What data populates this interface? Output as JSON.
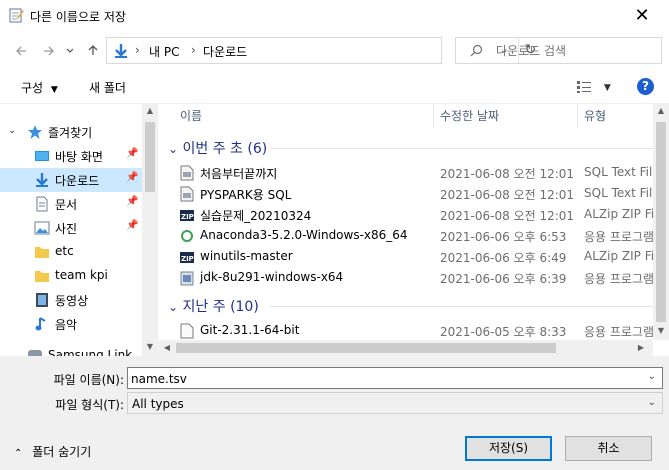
{
  "window": {
    "title": "다른 이름으로 저장",
    "close_glyph": "✕"
  },
  "nav": {
    "back_icon": "back-arrow-icon",
    "forward_icon": "forward-arrow-icon",
    "recent_icon": "chevron-down-icon",
    "up_icon": "up-arrow-icon"
  },
  "address": {
    "separator": "›",
    "crumbs": [
      "내 PC",
      "다운로드"
    ],
    "refresh_glyph": "↻"
  },
  "search": {
    "placeholder": "다운로드 검색"
  },
  "toolbar": {
    "organize_label": "구성",
    "new_folder_label": "새 폴더",
    "help_label": "?"
  },
  "sidebar": {
    "items": [
      {
        "label": "즐겨찾기",
        "icon": "star-icon"
      },
      {
        "label": "바탕 화면",
        "icon": "desktop-icon"
      },
      {
        "label": "다운로드",
        "icon": "download-icon"
      },
      {
        "label": "문서",
        "icon": "document-icon"
      },
      {
        "label": "사진",
        "icon": "picture-icon"
      },
      {
        "label": "etc",
        "icon": "folder-icon"
      },
      {
        "label": "team kpi",
        "icon": "folder-icon"
      },
      {
        "label": "동영상",
        "icon": "video-icon"
      },
      {
        "label": "음악",
        "icon": "music-icon"
      },
      {
        "label": "Samsung Link",
        "icon": "samsung-link-icon"
      }
    ]
  },
  "columns": {
    "name": "이름",
    "modified": "수정한 날짜",
    "type": "유형"
  },
  "groups": [
    {
      "title": "이번 주 초",
      "count": "(6)",
      "files": [
        {
          "name": "처음부터끝까지",
          "date": "2021-06-08 오전 12:01",
          "type": "SQL Text File",
          "icon": "sql-file-icon"
        },
        {
          "name": "PYSPARK용 SQL",
          "date": "2021-06-08 오전 12:01",
          "type": "SQL Text File",
          "icon": "sql-file-icon"
        },
        {
          "name": "실습문제_20210324",
          "date": "2021-06-08 오전 12:01",
          "type": "ALZip ZIP File",
          "icon": "zip-file-icon"
        },
        {
          "name": "Anaconda3-5.2.0-Windows-x86_64",
          "date": "2021-06-06 오후 6:53",
          "type": "응용 프로그램",
          "icon": "anaconda-icon"
        },
        {
          "name": "winutils-master",
          "date": "2021-06-06 오후 6:49",
          "type": "ALZip ZIP File",
          "icon": "zip-file-icon"
        },
        {
          "name": "jdk-8u291-windows-x64",
          "date": "2021-06-06 오후 6:39",
          "type": "응용 프로그램",
          "icon": "java-installer-icon"
        }
      ]
    },
    {
      "title": "지난 주",
      "count": "(10)",
      "files": [
        {
          "name": "Git-2.31.1-64-bit",
          "date": "2021-06-05 오후 8:33",
          "type": "응용 프로그램",
          "icon": "git-installer-icon"
        }
      ]
    }
  ],
  "form": {
    "filename_label": "파일 이름(N):",
    "filename_value": "name.tsv",
    "filetype_label": "파일 형식(T):",
    "filetype_value": "All types"
  },
  "footer": {
    "hide_folders_label": "폴더 숨기기",
    "save_label": "저장(S)",
    "cancel_label": "취소"
  },
  "colors": {
    "accent": "#0078d7",
    "selection": "#cce8ff",
    "group_heading": "#1e3287",
    "help_badge": "#1f5ed1"
  }
}
